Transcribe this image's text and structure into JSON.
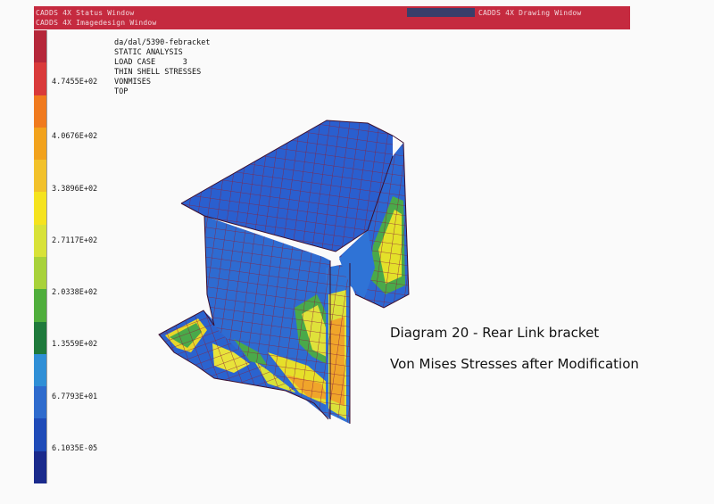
{
  "window": {
    "status_title": "CADDS 4X Status Window",
    "imagedesign_title": "CADDS 4X Imagedesign Window",
    "drawing_title": "CADDS 4X Drawing Window",
    "titlebar_color": "#c52a3f"
  },
  "analysis": {
    "file": "da/dal/5390-febracket",
    "type": "STATIC ANALYSIS",
    "load_case": "LOAD CASE      3",
    "element": "THIN SHELL STRESSES",
    "result": "VONMISES",
    "surface": "TOP"
  },
  "legend": {
    "colors": [
      "#b5273a",
      "#d93a3a",
      "#f07a1e",
      "#f2a21c",
      "#f2c12a",
      "#f5e31e",
      "#d8e238",
      "#a8d23a",
      "#4fae3c",
      "#1f7a3c",
      "#2f8fd6",
      "#2e6bcd",
      "#1e4bb8",
      "#1a2a8c"
    ],
    "labels": [
      "4.7455E+02",
      "4.0676E+02",
      "3.3896E+02",
      "2.7117E+02",
      "2.0338E+02",
      "1.3559E+02",
      "6.7793E+01",
      "6.1035E-05"
    ]
  },
  "caption": {
    "title": "Diagram 20 - Rear Link bracket",
    "subtitle": "Von Mises Stresses after Modification"
  }
}
